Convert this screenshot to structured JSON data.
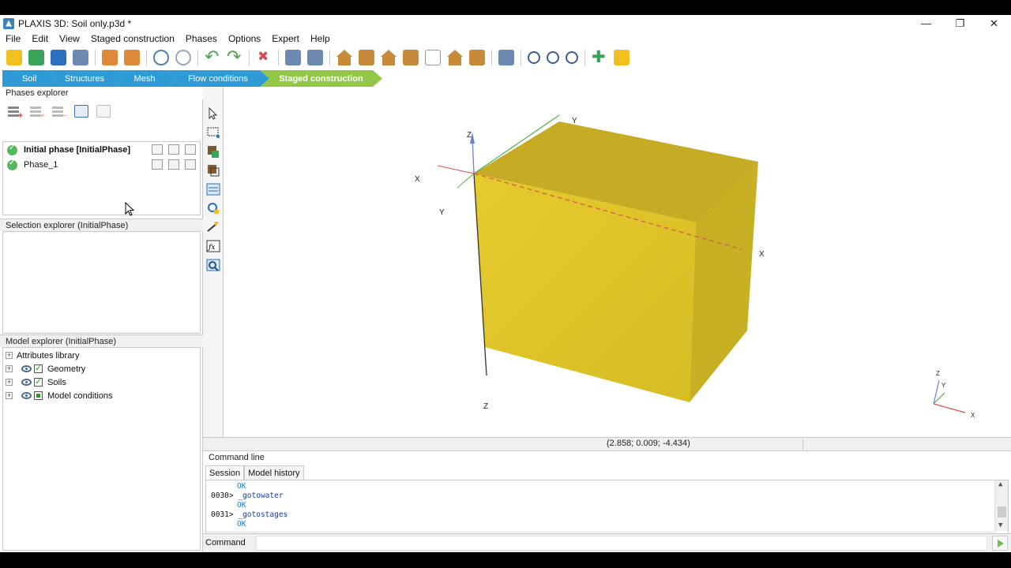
{
  "window": {
    "title": "PLAXIS 3D: Soil only.p3d *",
    "controls": {
      "minimize": "—",
      "restore": "❐",
      "close": "✕"
    }
  },
  "menu": [
    "File",
    "Edit",
    "View",
    "Staged construction",
    "Phases",
    "Options",
    "Expert",
    "Help"
  ],
  "ribbon": {
    "tabs": [
      "Soil",
      "Structures",
      "Mesh",
      "Flow conditions",
      "Staged construction"
    ],
    "active": "Staged construction",
    "colors": {
      "blue": "#2e9ad6",
      "green": "#92c845"
    }
  },
  "phases_explorer": {
    "title": "Phases explorer",
    "phases": [
      {
        "label": "Initial phase [InitialPhase]",
        "status": "ok"
      },
      {
        "label": "Phase_1",
        "status": "ok"
      }
    ]
  },
  "selection_explorer": {
    "title": "Selection explorer (InitialPhase)"
  },
  "model_explorer": {
    "title": "Model explorer (InitialPhase)",
    "items": [
      {
        "label": "Attributes library"
      },
      {
        "label": "Geometry"
      },
      {
        "label": "Soils"
      },
      {
        "label": "Model conditions"
      }
    ]
  },
  "viewport": {
    "axis_labels": {
      "x1": "X",
      "y1": "Y",
      "z1": "Z",
      "z_top": "Z",
      "y_top": "Y",
      "x_right": "X",
      "z_bottom": "Z"
    },
    "mini_axes": {
      "z": "Z",
      "y": "Y",
      "x": "X"
    },
    "soil_color": "#d9c12d"
  },
  "status": {
    "coordinates": "(2.858; 0.009; -4.434)"
  },
  "command_panel": {
    "title": "Command line",
    "tabs": [
      "Session",
      "Model history"
    ],
    "log": [
      {
        "num": "",
        "text": "OK"
      },
      {
        "num": "0030>",
        "text": "_gotowater"
      },
      {
        "num": "",
        "text": "OK"
      },
      {
        "num": "0031>",
        "text": "_gotostages"
      },
      {
        "num": "",
        "text": "OK"
      }
    ]
  },
  "command_input": {
    "label": "Command",
    "value": ""
  }
}
